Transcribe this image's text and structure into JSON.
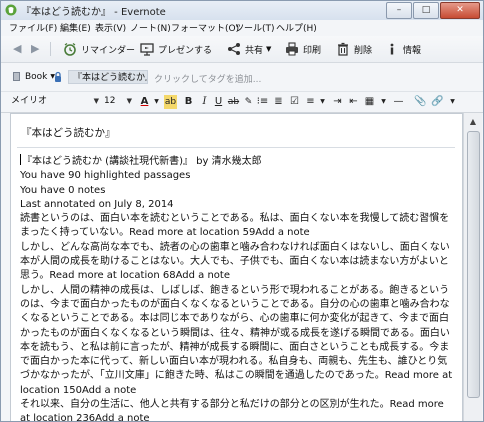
{
  "window": {
    "title": "『本はどう読むか』 - Evernote",
    "controls": {
      "minimize": "–",
      "maximize": "□",
      "close": "✕"
    }
  },
  "menubar": {
    "items": [
      "ファイル(F)",
      "編集(E)",
      "表示(V)",
      "ノート(N)",
      "フォーマット(O)",
      "ツール(T)",
      "ヘルプ(H)"
    ]
  },
  "toolbar": {
    "reminder_label": "リマインダー",
    "present_label": "プレゼンする",
    "share_label": "共有",
    "print_label": "印刷",
    "delete_label": "削除",
    "info_label": "情報",
    "accent_color": "#4a7c3a"
  },
  "tagbar": {
    "notebook": "Book",
    "tag_chip": "『本はどう読むか』",
    "tag_placeholder": "クリックしてタグを追加..."
  },
  "format": {
    "font": "メイリオ",
    "size": "12"
  },
  "note": {
    "title": "『本はどう読むか』",
    "lines": {
      "l1": "『本はどう読むか (講談社現代新書)』 by 清水幾太郎",
      "l2": "You have 90 highlighted passages",
      "l3": "You have 0 notes",
      "l4": "Last annotated on July 8, 2014",
      "p1": "読書というのは、面白い本を読むということである。私は、面白くない本を我慢して読む習慣をまったく持っていない。",
      "p1_link": "Read more at location 59Add a note",
      "p2": "しかし、どんな高尚な本でも、読者の心の歯車と噛み合わなければ面白くはないし、面白くない本が人間の成長を助けることはない。大人でも、子供でも、面白くない本は読まない方がよいと思う。",
      "p2_link": "Read more at location 68Add a note",
      "p3": "しかし、人間の精神の成長は、しばしば、飽きるという形で現われることがある。飽きるというのは、今まで面白かったものが面白くなくなるということである。自分の心の歯車と噛み合わなくなるということである。本は同じ本でありながら、心の歯車に何か変化が起きて、今まで面白かったものが面白くなくなるという瞬間は、往々、精神が或る成長を遂げる瞬間である。面白い本を読もう、と私は前に言ったが、精神が成長する瞬間に、面白さということも成長する。今まで面白かった本に代って、新しい面白い本が現われる。私自身も、両親も、先生も、誰ひとり気づかなかったが、「立川文庫」に飽きた時、私はこの瞬間を通過したのであった。",
      "p3_link": "Read more at location 150Add a note",
      "p4": "それ以来、自分の生活に、他人と共有する部分と私だけの部分との区別が生れた。",
      "p4_link": "Read more at location 236Add a note"
    }
  }
}
